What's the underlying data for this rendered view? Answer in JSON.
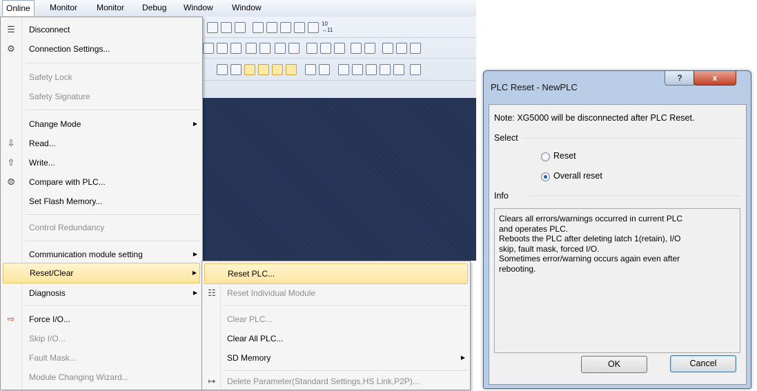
{
  "menubar": {
    "items": [
      "Online",
      "Monitor",
      "Monitor",
      "Debug",
      "Window",
      "Window"
    ]
  },
  "online_menu": {
    "items": [
      {
        "label": "Disconnect",
        "icon": "disconnect-icon",
        "disabled": false
      },
      {
        "label": "Connection Settings...",
        "icon": "connection-settings-icon",
        "disabled": false
      },
      {
        "label": "Safety Lock",
        "disabled": true
      },
      {
        "label": "Safety Signature",
        "disabled": true
      },
      {
        "label": "Change Mode",
        "submenu": true
      },
      {
        "label": "Read...",
        "icon": "read-icon"
      },
      {
        "label": "Write...",
        "icon": "write-icon"
      },
      {
        "label": "Compare with PLC...",
        "icon": "compare-icon"
      },
      {
        "label": "Set Flash Memory..."
      },
      {
        "label": "Control Redundancy",
        "disabled": true
      },
      {
        "label": "Communication module setting",
        "submenu": true
      },
      {
        "label": "Reset/Clear",
        "submenu": true,
        "highlighted": true
      },
      {
        "label": "Diagnosis",
        "submenu": true
      },
      {
        "label": "Force I/O...",
        "icon": "force-io-icon"
      },
      {
        "label": "Skip I/O...",
        "disabled": true
      },
      {
        "label": "Fault Mask...",
        "disabled": true
      },
      {
        "label": "Module Changing Wizard...",
        "disabled": true
      }
    ]
  },
  "reset_submenu": {
    "items": [
      {
        "label": "Reset PLC...",
        "highlighted": true
      },
      {
        "label": "Reset Individual Module",
        "disabled": true,
        "icon": "reset-module-icon"
      },
      {
        "label": "Clear PLC...",
        "disabled": true
      },
      {
        "label": "Clear All PLC..."
      },
      {
        "label": "SD Memory",
        "submenu": true
      },
      {
        "label": "Delete Parameter(Standard Settings,HS Link,P2P)...",
        "disabled": true,
        "icon": "delete-parameter-icon"
      }
    ]
  },
  "toolbar": {
    "zoom_label": "10\n→11"
  },
  "dialog": {
    "title": "PLC Reset - NewPLC",
    "help_label": "?",
    "close_label": "x",
    "note": "Note: XG5000 will be disconnected after PLC Reset.",
    "select_label": "Select",
    "options": [
      {
        "label": "Reset",
        "checked": false
      },
      {
        "label": "Overall reset",
        "checked": true
      }
    ],
    "info_label": "Info",
    "info_lines": [
      "Clears all errors/warnings occurred in current PLC",
      "and operates PLC.",
      "Reboots the PLC after deleting latch 1(retain), I/O",
      "skip, fault mask, forced I/O.",
      "Sometimes error/warning occurs again even after",
      "rebooting."
    ],
    "ok_label": "OK",
    "cancel_label": "Cancel"
  },
  "colors": {
    "highlight": "#fde5a0",
    "dialog_frame": "#b9cde6",
    "close_button": "#c24227",
    "background_dark": "#243457"
  }
}
